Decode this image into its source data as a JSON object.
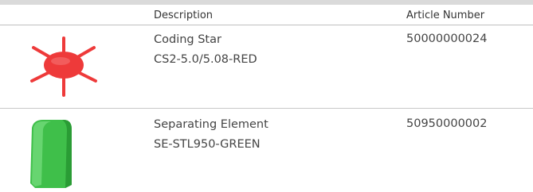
{
  "table": {
    "headers": {
      "description": "Description",
      "article_number": "Article Number"
    },
    "rows": [
      {
        "name": "Coding Star",
        "code": "CS2-5.0/5.08-RED",
        "article_number": "50000000024",
        "image": "coding-star-red",
        "color": "#ee3a3a"
      },
      {
        "name": "Separating Element",
        "code": "SE-STL950-GREEN",
        "article_number": "50950000002",
        "image": "separating-element-green",
        "color": "#3fbf4a"
      }
    ]
  }
}
